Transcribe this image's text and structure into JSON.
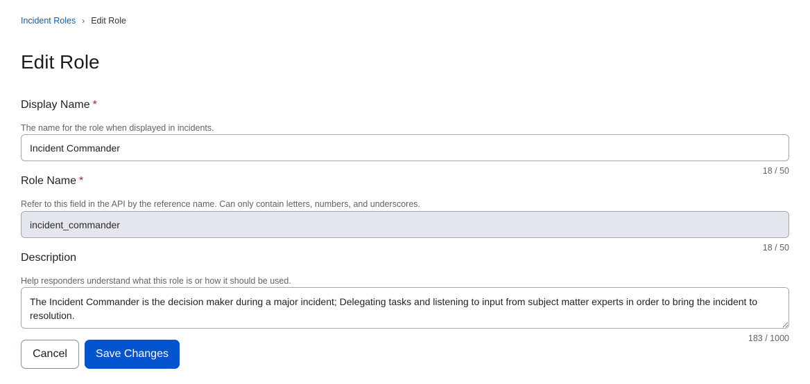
{
  "breadcrumb": {
    "parent": "Incident Roles",
    "separator": "›",
    "current": "Edit Role"
  },
  "page_title": "Edit Role",
  "fields": {
    "display_name": {
      "label": "Display Name",
      "required_mark": "*",
      "help": "The name for the role when displayed in incidents.",
      "value": "Incident Commander",
      "counter": "18 / 50"
    },
    "role_name": {
      "label": "Role Name",
      "required_mark": "*",
      "help": "Refer to this field in the API by the reference name. Can only contain letters, numbers, and underscores.",
      "value": "incident_commander",
      "counter": "18 / 50",
      "disabled": true
    },
    "description": {
      "label": "Description",
      "help": "Help responders understand what this role is or how it should be used.",
      "value": "The Incident Commander is the decision maker during a major incident; Delegating tasks and listening to input from subject matter experts in order to bring the incident to resolution.",
      "counter": "183 / 1000"
    }
  },
  "actions": {
    "cancel_label": "Cancel",
    "save_label": "Save Changes"
  },
  "colors": {
    "link": "#0a5fb4",
    "primary": "#0454cf",
    "required": "#c8102e",
    "disabled_bg": "#e3e7ed"
  }
}
